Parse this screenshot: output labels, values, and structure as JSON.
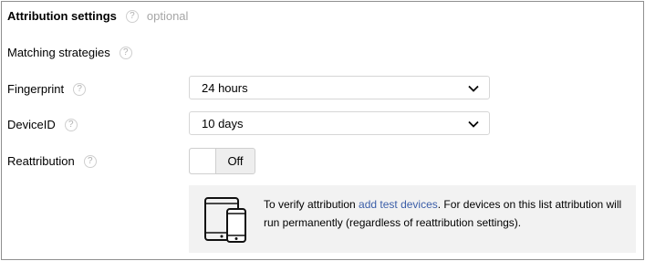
{
  "section": {
    "title": "Attribution settings",
    "optional": "optional"
  },
  "help_glyph": "?",
  "matching": {
    "label": "Matching strategies"
  },
  "fingerprint": {
    "label": "Fingerprint",
    "value": "24 hours"
  },
  "deviceid": {
    "label": "DeviceID",
    "value": "10 days"
  },
  "reattribution": {
    "label": "Reattribution",
    "toggle_state": "Off"
  },
  "notice": {
    "text_before": "To verify attribution ",
    "link": "add test devices",
    "text_after": ". For devices on this list attribution will run permanently (regardless of reattribution settings)."
  },
  "icons": [
    "help-icon",
    "chevron-down-icon",
    "devices-icon"
  ]
}
